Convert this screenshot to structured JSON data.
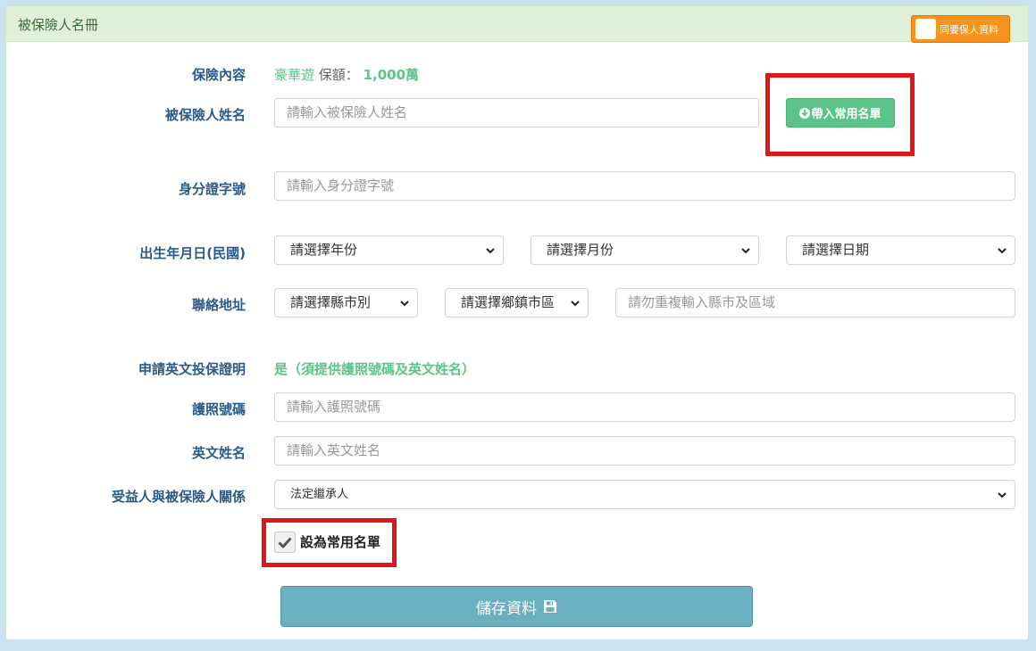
{
  "header": {
    "title": "被保險人名冊",
    "same_as_proposer_label": "同要保人資料"
  },
  "insurance": {
    "label": "保險內容",
    "plan": "豪華遊",
    "amount_label": "保額：",
    "amount": "1,000萬"
  },
  "name": {
    "label": "被保險人姓名",
    "placeholder": "請輸入被保險人姓名",
    "load_button": "帶入常用名單"
  },
  "id_number": {
    "label": "身分證字號",
    "placeholder": "請輸入身分證字號"
  },
  "birthday": {
    "label": "出生年月日(民國)",
    "year": "請選擇年份",
    "month": "請選擇月份",
    "day": "請選擇日期"
  },
  "address": {
    "label": "聯絡地址",
    "city": "請選擇縣市別",
    "district": "請選擇鄉鎮市區",
    "detail_placeholder": "請勿重複輸入縣市及區域"
  },
  "english_cert": {
    "label": "申請英文投保證明",
    "value": "是（須提供護照號碼及英文姓名）"
  },
  "passport": {
    "label": "護照號碼",
    "placeholder": "請輸入護照號碼"
  },
  "english_name": {
    "label": "英文姓名",
    "placeholder": "請輸入英文姓名"
  },
  "beneficiary": {
    "label": "受益人與被保險人關係",
    "value": "法定繼承人"
  },
  "favorite": {
    "label": "設為常用名單",
    "checked": true
  },
  "save_button": {
    "label": "儲存資料"
  },
  "colors": {
    "accent_green": "#5cc488",
    "label_blue": "#2a5a8a",
    "orange": "#f7941d",
    "save_teal": "#6ab0c0",
    "highlight_red": "#e0161b"
  }
}
